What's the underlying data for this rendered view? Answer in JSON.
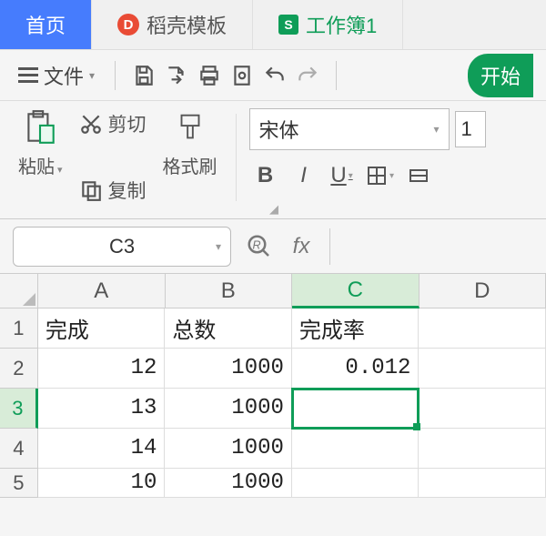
{
  "tabs": {
    "home": "首页",
    "template": "稻壳模板",
    "workbook": "工作簿1",
    "template_icon_glyph": "D",
    "sheet_icon_glyph": "S"
  },
  "menu": {
    "file": "文件"
  },
  "start_label": "开始",
  "ribbon": {
    "paste": "粘贴",
    "cut": "剪切",
    "copy": "复制",
    "format_painter": "格式刷",
    "font_name": "宋体",
    "font_size": "1",
    "bold": "B",
    "italic": "I",
    "underline": "U"
  },
  "name_box": "C3",
  "fx_label": "fx",
  "columns": [
    "A",
    "B",
    "C",
    "D"
  ],
  "rows": [
    "1",
    "2",
    "3",
    "4",
    "5"
  ],
  "grid": {
    "r1": {
      "A": "完成",
      "B": "总数",
      "C": "完成率",
      "D": ""
    },
    "r2": {
      "A": "12",
      "B": "1000",
      "C": "0.012",
      "D": ""
    },
    "r3": {
      "A": "13",
      "B": "1000",
      "C": "",
      "D": ""
    },
    "r4": {
      "A": "14",
      "B": "1000",
      "C": "",
      "D": ""
    },
    "r5": {
      "A": "10",
      "B": "1000",
      "C": "",
      "D": ""
    }
  },
  "active_cell": "C3"
}
